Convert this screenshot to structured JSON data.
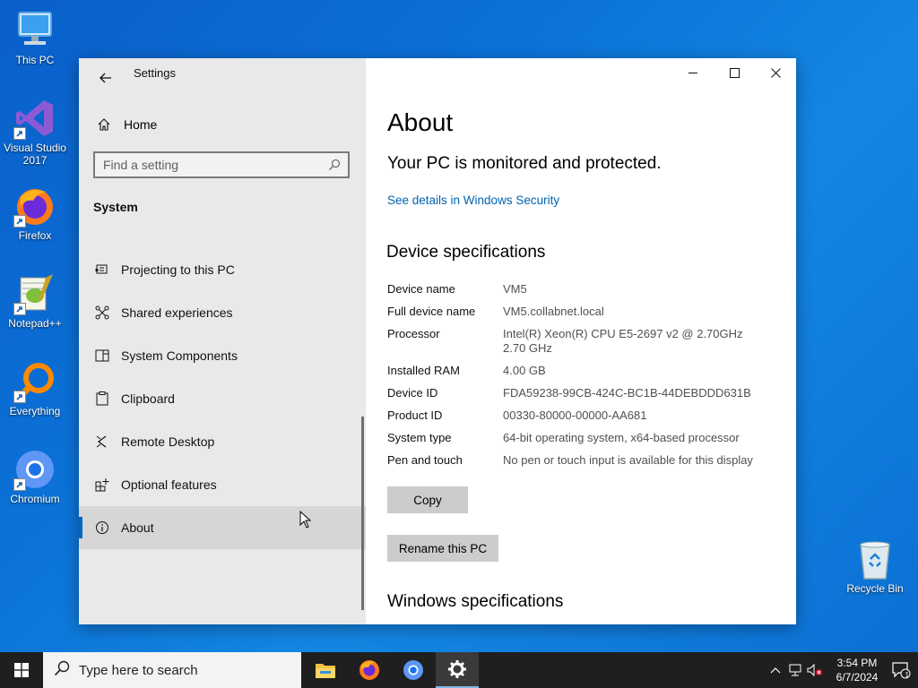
{
  "desktop": {
    "icons": [
      {
        "label": "This PC"
      },
      {
        "label": "Visual Studio 2017"
      },
      {
        "label": "Firefox"
      },
      {
        "label": "Notepad++"
      },
      {
        "label": "Everything"
      },
      {
        "label": "Chromium"
      }
    ],
    "recycle_bin": {
      "label": "Recycle Bin"
    }
  },
  "window": {
    "title": "Settings",
    "caption_buttons": [
      "minimize-icon",
      "maximize-icon",
      "close-icon"
    ]
  },
  "sidebar": {
    "home_label": "Home",
    "search_placeholder": "Find a setting",
    "section_title": "System",
    "items": [
      {
        "label": "Projecting to this PC",
        "icon": "projector-icon"
      },
      {
        "label": "Shared experiences",
        "icon": "shared-icon"
      },
      {
        "label": "System Components",
        "icon": "components-icon"
      },
      {
        "label": "Clipboard",
        "icon": "clipboard-icon"
      },
      {
        "label": "Remote Desktop",
        "icon": "remote-desktop-icon"
      },
      {
        "label": "Optional features",
        "icon": "optional-features-icon"
      },
      {
        "label": "About",
        "icon": "info-icon",
        "selected": true
      }
    ]
  },
  "main": {
    "page_title": "About",
    "protection_status": "Your PC is monitored and protected.",
    "security_link": "See details in Windows Security",
    "device_spec_heading": "Device specifications",
    "specs": [
      {
        "key": "Device name",
        "value": "VM5"
      },
      {
        "key": "Full device name",
        "value": "VM5.collabnet.local"
      },
      {
        "key": "Processor",
        "value": "Intel(R) Xeon(R) CPU E5-2697 v2 @ 2.70GHz   2.70 GHz"
      },
      {
        "key": "Installed RAM",
        "value": "4.00 GB"
      },
      {
        "key": "Device ID",
        "value": "FDA59238-99CB-424C-BC1B-44DEBDDD631B"
      },
      {
        "key": "Product ID",
        "value": "00330-80000-00000-AA681"
      },
      {
        "key": "System type",
        "value": "64-bit operating system, x64-based processor"
      },
      {
        "key": "Pen and touch",
        "value": "No pen or touch input is available for this display"
      }
    ],
    "copy_button": "Copy",
    "rename_button": "Rename this PC",
    "windows_spec_heading": "Windows specifications"
  },
  "taskbar": {
    "search_placeholder": "Type here to search",
    "apps": [
      "file-explorer-icon",
      "firefox-icon",
      "chromium-icon",
      "settings-icon"
    ],
    "time": "3:54 PM",
    "date": "6/7/2024",
    "notification_count": "1"
  },
  "colors": {
    "accent": "#0067c0",
    "link": "#0063b1",
    "desktop": "#0b72d8"
  }
}
